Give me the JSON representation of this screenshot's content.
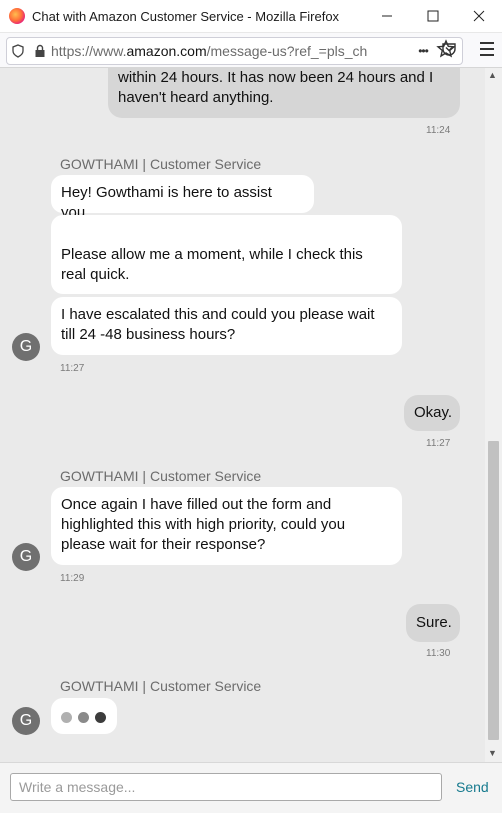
{
  "window": {
    "title": "Chat with Amazon Customer Service - Mozilla Firefox",
    "icon": "firefox-logo-icon",
    "controls": [
      "minimize-icon",
      "maximize-icon",
      "close-icon"
    ]
  },
  "urlbar": {
    "url_prefix": "https://www.",
    "url_domain": "amazon.com",
    "url_suffix": "/message-us?ref_=pls_ch",
    "more_label": "•••",
    "icons": [
      "shield-icon",
      "lock-icon",
      "pocket-icon",
      "star-icon",
      "hamburger-menu-icon"
    ]
  },
  "chat": {
    "msg1": {
      "line1": "within 24 hours. It has now been 24 hours and I",
      "line2": "haven't heard anything.",
      "time": "11:24"
    },
    "agent_block1": {
      "name": "GOWTHAMI | Customer Service",
      "b1": "Hey! Gowthami is here to assist you.",
      "b2_line1": "Please allow me a moment, while I check this",
      "b2_line2": "real quick.",
      "b3_line1": "I have escalated this and could you please wait",
      "b3_line2": "till 24 -48 business hours?",
      "avatar": "G",
      "time": "11:27"
    },
    "msg2": {
      "text": "Okay.",
      "time": "11:27"
    },
    "agent_block2": {
      "name": "GOWTHAMI | Customer Service",
      "line1": "Once again I have filled out the form and",
      "line2": "highlighted this with high priority, could you",
      "line3": "please wait for their response?",
      "avatar": "G",
      "time": "11:29"
    },
    "msg3": {
      "text": "Sure.",
      "time": "11:30"
    },
    "agent_block3": {
      "name": "GOWTHAMI | Customer Service",
      "avatar": "G",
      "typing_dot_colors": [
        "#b0b0b0",
        "#8a8a8a",
        "#3c3c3c"
      ]
    }
  },
  "input": {
    "placeholder": "Write a message...",
    "send_label": "Send"
  },
  "colors": {
    "accent": "#167a8e",
    "chat_bg": "#eaeaea",
    "user_bubble": "#d6d6d6",
    "avatar": "#707070"
  }
}
